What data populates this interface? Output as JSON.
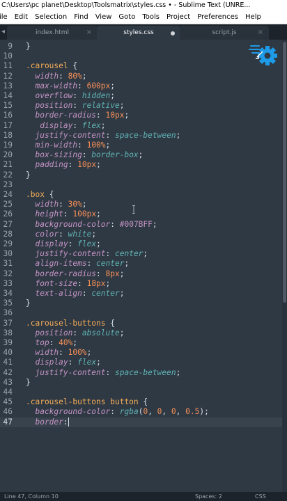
{
  "window": {
    "title": "C:\\Users\\pc planet\\Desktop\\Toolsmatrix\\styles.css • - Sublime Text (UNRE..."
  },
  "menu": [
    "ile",
    "Edit",
    "Selection",
    "Find",
    "View",
    "Goto",
    "Tools",
    "Project",
    "Preferences",
    "Help"
  ],
  "tabs": [
    {
      "label": "index.html",
      "state": "close"
    },
    {
      "label": "styles.css",
      "state": "modified"
    },
    {
      "label": "script.js",
      "state": "close"
    }
  ],
  "editor": {
    "current_line": 47,
    "lines": [
      {
        "n": "9",
        "tokens": [
          {
            "t": "}",
            "c": "punc"
          }
        ]
      },
      {
        "n": "10",
        "tokens": []
      },
      {
        "n": "11",
        "tokens": [
          {
            "t": ".carousel",
            "c": "sel"
          },
          {
            "t": " {",
            "c": "punc"
          }
        ]
      },
      {
        "n": "12",
        "tokens": [
          {
            "t": "  width",
            "c": "prop"
          },
          {
            "t": ": ",
            "c": "punc"
          },
          {
            "t": "80%",
            "c": "num"
          },
          {
            "t": ";",
            "c": "punc"
          }
        ]
      },
      {
        "n": "13",
        "tokens": [
          {
            "t": "  max-width",
            "c": "prop"
          },
          {
            "t": ": ",
            "c": "punc"
          },
          {
            "t": "600px",
            "c": "num"
          },
          {
            "t": ";",
            "c": "punc"
          }
        ]
      },
      {
        "n": "14",
        "tokens": [
          {
            "t": "  overflow",
            "c": "prop"
          },
          {
            "t": ": ",
            "c": "punc"
          },
          {
            "t": "hidden",
            "c": "val"
          },
          {
            "t": ";",
            "c": "punc"
          }
        ]
      },
      {
        "n": "15",
        "tokens": [
          {
            "t": "  position",
            "c": "prop"
          },
          {
            "t": ": ",
            "c": "punc"
          },
          {
            "t": "relative",
            "c": "val"
          },
          {
            "t": ";",
            "c": "punc"
          }
        ]
      },
      {
        "n": "16",
        "tokens": [
          {
            "t": "  border-radius",
            "c": "prop"
          },
          {
            "t": ": ",
            "c": "punc"
          },
          {
            "t": "10px",
            "c": "num"
          },
          {
            "t": ";",
            "c": "punc"
          }
        ]
      },
      {
        "n": "17",
        "tokens": [
          {
            "t": "   display",
            "c": "prop"
          },
          {
            "t": ": ",
            "c": "punc"
          },
          {
            "t": "flex",
            "c": "val"
          },
          {
            "t": ";",
            "c": "punc"
          }
        ]
      },
      {
        "n": "18",
        "tokens": [
          {
            "t": "  justify-content",
            "c": "prop"
          },
          {
            "t": ": ",
            "c": "punc"
          },
          {
            "t": "space-between",
            "c": "val"
          },
          {
            "t": ";",
            "c": "punc"
          }
        ]
      },
      {
        "n": "19",
        "tokens": [
          {
            "t": "  min-width",
            "c": "prop"
          },
          {
            "t": ": ",
            "c": "punc"
          },
          {
            "t": "100%",
            "c": "num"
          },
          {
            "t": ";",
            "c": "punc"
          }
        ]
      },
      {
        "n": "20",
        "tokens": [
          {
            "t": "  box-sizing",
            "c": "prop"
          },
          {
            "t": ": ",
            "c": "punc"
          },
          {
            "t": "border-box",
            "c": "val"
          },
          {
            "t": ";",
            "c": "punc"
          }
        ]
      },
      {
        "n": "21",
        "tokens": [
          {
            "t": "  padding",
            "c": "prop"
          },
          {
            "t": ": ",
            "c": "punc"
          },
          {
            "t": "10px",
            "c": "num"
          },
          {
            "t": ";",
            "c": "punc"
          }
        ]
      },
      {
        "n": "22",
        "tokens": [
          {
            "t": "}",
            "c": "punc"
          }
        ]
      },
      {
        "n": "23",
        "tokens": []
      },
      {
        "n": "24",
        "tokens": [
          {
            "t": ".box",
            "c": "sel"
          },
          {
            "t": " {",
            "c": "punc"
          }
        ]
      },
      {
        "n": "25",
        "tokens": [
          {
            "t": "  width",
            "c": "prop"
          },
          {
            "t": ": ",
            "c": "punc"
          },
          {
            "t": "30%",
            "c": "num"
          },
          {
            "t": ";",
            "c": "punc"
          }
        ]
      },
      {
        "n": "26",
        "tokens": [
          {
            "t": "  height",
            "c": "prop"
          },
          {
            "t": ": ",
            "c": "punc"
          },
          {
            "t": "100px",
            "c": "num"
          },
          {
            "t": ";",
            "c": "punc"
          }
        ]
      },
      {
        "n": "27",
        "tokens": [
          {
            "t": "  background-color",
            "c": "prop"
          },
          {
            "t": ": ",
            "c": "punc"
          },
          {
            "t": "#007BFF",
            "c": "hex"
          },
          {
            "t": ";",
            "c": "punc"
          }
        ]
      },
      {
        "n": "28",
        "tokens": [
          {
            "t": "  color",
            "c": "prop"
          },
          {
            "t": ": ",
            "c": "punc"
          },
          {
            "t": "white",
            "c": "val"
          },
          {
            "t": ";",
            "c": "punc"
          }
        ]
      },
      {
        "n": "29",
        "tokens": [
          {
            "t": "  display",
            "c": "prop"
          },
          {
            "t": ": ",
            "c": "punc"
          },
          {
            "t": "flex",
            "c": "val"
          },
          {
            "t": ";",
            "c": "punc"
          }
        ]
      },
      {
        "n": "30",
        "tokens": [
          {
            "t": "  justify-content",
            "c": "prop"
          },
          {
            "t": ": ",
            "c": "punc"
          },
          {
            "t": "center",
            "c": "val"
          },
          {
            "t": ";",
            "c": "punc"
          }
        ]
      },
      {
        "n": "31",
        "tokens": [
          {
            "t": "  align-items",
            "c": "prop"
          },
          {
            "t": ": ",
            "c": "punc"
          },
          {
            "t": "center",
            "c": "val"
          },
          {
            "t": ";",
            "c": "punc"
          }
        ]
      },
      {
        "n": "32",
        "tokens": [
          {
            "t": "  border-radius",
            "c": "prop"
          },
          {
            "t": ": ",
            "c": "punc"
          },
          {
            "t": "8px",
            "c": "num"
          },
          {
            "t": ";",
            "c": "punc"
          }
        ]
      },
      {
        "n": "33",
        "tokens": [
          {
            "t": "  font-size",
            "c": "prop"
          },
          {
            "t": ": ",
            "c": "punc"
          },
          {
            "t": "18px",
            "c": "num"
          },
          {
            "t": ";",
            "c": "punc"
          }
        ]
      },
      {
        "n": "34",
        "tokens": [
          {
            "t": "  text-align",
            "c": "prop"
          },
          {
            "t": ": ",
            "c": "punc"
          },
          {
            "t": "center",
            "c": "val"
          },
          {
            "t": ";",
            "c": "punc"
          }
        ]
      },
      {
        "n": "35",
        "tokens": [
          {
            "t": "}",
            "c": "punc"
          }
        ]
      },
      {
        "n": "36",
        "tokens": []
      },
      {
        "n": "37",
        "tokens": [
          {
            "t": ".carousel-buttons",
            "c": "sel"
          },
          {
            "t": " {",
            "c": "punc"
          }
        ]
      },
      {
        "n": "38",
        "tokens": [
          {
            "t": "  position",
            "c": "prop"
          },
          {
            "t": ": ",
            "c": "punc"
          },
          {
            "t": "absolute",
            "c": "val"
          },
          {
            "t": ";",
            "c": "punc"
          }
        ]
      },
      {
        "n": "39",
        "tokens": [
          {
            "t": "  top",
            "c": "prop"
          },
          {
            "t": ": ",
            "c": "punc"
          },
          {
            "t": "40%",
            "c": "num"
          },
          {
            "t": ";",
            "c": "punc"
          }
        ]
      },
      {
        "n": "40",
        "tokens": [
          {
            "t": "  width",
            "c": "prop"
          },
          {
            "t": ": ",
            "c": "punc"
          },
          {
            "t": "100%",
            "c": "num"
          },
          {
            "t": ";",
            "c": "punc"
          }
        ]
      },
      {
        "n": "41",
        "tokens": [
          {
            "t": "  display",
            "c": "prop"
          },
          {
            "t": ": ",
            "c": "punc"
          },
          {
            "t": "flex",
            "c": "val"
          },
          {
            "t": ";",
            "c": "punc"
          }
        ]
      },
      {
        "n": "42",
        "tokens": [
          {
            "t": "  justify-content",
            "c": "prop"
          },
          {
            "t": ": ",
            "c": "punc"
          },
          {
            "t": "space-between",
            "c": "val"
          },
          {
            "t": ";",
            "c": "punc"
          }
        ]
      },
      {
        "n": "43",
        "tokens": [
          {
            "t": "}",
            "c": "punc"
          }
        ]
      },
      {
        "n": "44",
        "tokens": []
      },
      {
        "n": "45",
        "tokens": [
          {
            "t": ".carousel-buttons button",
            "c": "sel"
          },
          {
            "t": " {",
            "c": "punc"
          }
        ]
      },
      {
        "n": "46",
        "tokens": [
          {
            "t": "  background-color",
            "c": "prop"
          },
          {
            "t": ": ",
            "c": "punc"
          },
          {
            "t": "rgba",
            "c": "fn"
          },
          {
            "t": "(",
            "c": "punc"
          },
          {
            "t": "0",
            "c": "num"
          },
          {
            "t": ", ",
            "c": "punc"
          },
          {
            "t": "0",
            "c": "num"
          },
          {
            "t": ", ",
            "c": "punc"
          },
          {
            "t": "0",
            "c": "num"
          },
          {
            "t": ", ",
            "c": "punc"
          },
          {
            "t": "0.5",
            "c": "num"
          },
          {
            "t": ");",
            "c": "punc"
          }
        ]
      },
      {
        "n": "47",
        "tokens": [
          {
            "t": "  border",
            "c": "prop"
          },
          {
            "t": ":",
            "c": "punc"
          }
        ]
      }
    ]
  },
  "status": {
    "position": "Line 47, Column 10",
    "spaces": "Spaces: 2",
    "syntax": "CSS"
  },
  "colors": {
    "editor_bg": "#2f3944",
    "selector": "#f6ad57",
    "property": "#c594c5",
    "value": "#5fb3b3",
    "number": "#f99157",
    "logo": "#1e9be8"
  },
  "icons": [
    "tab-nav-arrow-icon",
    "tab-close-icon",
    "tab-modified-dot-icon",
    "toolsmatrix-gear-logo",
    "text-cursor-icon"
  ]
}
